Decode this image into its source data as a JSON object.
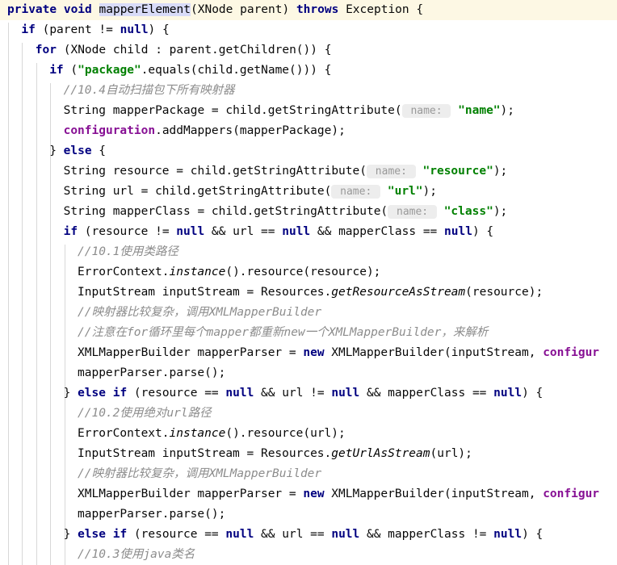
{
  "editor": {
    "language": "java",
    "theme": "IntelliJ Light",
    "colors": {
      "background": "#ffffff",
      "current_line_highlight": "#fdf8e4",
      "identifier_occurrence_highlight": "#d8dbf8",
      "keyword": "#000080",
      "string": "#008000",
      "comment": "#8c8c8c",
      "field": "#871094",
      "plain_text": "#080808",
      "indent_guide": "#d8d8d8",
      "param_hint_background": "#ededed",
      "param_hint_text": "#999999"
    },
    "indent_guide_x": [
      10,
      27,
      45,
      62,
      80,
      97
    ],
    "line_height": 25
  },
  "code_lines": [
    {
      "n": 1,
      "indent": 0,
      "current": true,
      "tokens": [
        {
          "t": "private",
          "c": "kw"
        },
        {
          "t": " ",
          "c": "pln"
        },
        {
          "t": "void",
          "c": "kw"
        },
        {
          "t": " ",
          "c": "pln"
        },
        {
          "t": "mapperElement",
          "c": "sel"
        },
        {
          "t": "(XNode parent) ",
          "c": "pln"
        },
        {
          "t": "throws",
          "c": "kw"
        },
        {
          "t": " Exception {",
          "c": "pln"
        }
      ]
    },
    {
      "n": 2,
      "indent": 1,
      "tokens": [
        {
          "t": "if",
          "c": "kw"
        },
        {
          "t": " (parent != ",
          "c": "pln"
        },
        {
          "t": "null",
          "c": "kw"
        },
        {
          "t": ") {",
          "c": "pln"
        }
      ]
    },
    {
      "n": 3,
      "indent": 2,
      "tokens": [
        {
          "t": "for",
          "c": "kw"
        },
        {
          "t": " (XNode child : parent.getChildren()) {",
          "c": "pln"
        }
      ]
    },
    {
      "n": 4,
      "indent": 3,
      "tokens": [
        {
          "t": "if",
          "c": "kw"
        },
        {
          "t": " (",
          "c": "pln"
        },
        {
          "t": "\"package\"",
          "c": "str"
        },
        {
          "t": ".equals(child.getName())) {",
          "c": "pln"
        }
      ]
    },
    {
      "n": 5,
      "indent": 4,
      "tokens": [
        {
          "t": "//10.4自动扫描包下所有映射器",
          "c": "cmt"
        }
      ]
    },
    {
      "n": 6,
      "indent": 4,
      "tokens": [
        {
          "t": "String mapperPackage = child.getStringAttribute(",
          "c": "pln"
        },
        {
          "t": " name: ",
          "c": "hint"
        },
        {
          "t": " ",
          "c": "pln"
        },
        {
          "t": "\"name\"",
          "c": "str"
        },
        {
          "t": ");",
          "c": "pln"
        }
      ]
    },
    {
      "n": 7,
      "indent": 4,
      "tokens": [
        {
          "t": "configuration",
          "c": "fld"
        },
        {
          "t": ".addMappers(mapperPackage);",
          "c": "pln"
        }
      ]
    },
    {
      "n": 8,
      "indent": 3,
      "tokens": [
        {
          "t": "} ",
          "c": "pln"
        },
        {
          "t": "else",
          "c": "kw"
        },
        {
          "t": " {",
          "c": "pln"
        }
      ]
    },
    {
      "n": 9,
      "indent": 4,
      "tokens": [
        {
          "t": "String resource = child.getStringAttribute(",
          "c": "pln"
        },
        {
          "t": " name: ",
          "c": "hint"
        },
        {
          "t": " ",
          "c": "pln"
        },
        {
          "t": "\"resource\"",
          "c": "str"
        },
        {
          "t": ");",
          "c": "pln"
        }
      ]
    },
    {
      "n": 10,
      "indent": 4,
      "tokens": [
        {
          "t": "String url = child.getStringAttribute(",
          "c": "pln"
        },
        {
          "t": " name: ",
          "c": "hint"
        },
        {
          "t": " ",
          "c": "pln"
        },
        {
          "t": "\"url\"",
          "c": "str"
        },
        {
          "t": ");",
          "c": "pln"
        }
      ]
    },
    {
      "n": 11,
      "indent": 4,
      "tokens": [
        {
          "t": "String mapperClass = child.getStringAttribute(",
          "c": "pln"
        },
        {
          "t": " name: ",
          "c": "hint"
        },
        {
          "t": " ",
          "c": "pln"
        },
        {
          "t": "\"class\"",
          "c": "str"
        },
        {
          "t": ");",
          "c": "pln"
        }
      ]
    },
    {
      "n": 12,
      "indent": 4,
      "tokens": [
        {
          "t": "if",
          "c": "kw"
        },
        {
          "t": " (resource != ",
          "c": "pln"
        },
        {
          "t": "null",
          "c": "kw"
        },
        {
          "t": " && url == ",
          "c": "pln"
        },
        {
          "t": "null",
          "c": "kw"
        },
        {
          "t": " && mapperClass == ",
          "c": "pln"
        },
        {
          "t": "null",
          "c": "kw"
        },
        {
          "t": ") {",
          "c": "pln"
        }
      ]
    },
    {
      "n": 13,
      "indent": 5,
      "tokens": [
        {
          "t": "//10.1使用类路径",
          "c": "cmt"
        }
      ]
    },
    {
      "n": 14,
      "indent": 5,
      "tokens": [
        {
          "t": "ErrorContext.",
          "c": "pln"
        },
        {
          "t": "instance",
          "c": "stm"
        },
        {
          "t": "().resource(resource);",
          "c": "pln"
        }
      ]
    },
    {
      "n": 15,
      "indent": 5,
      "tokens": [
        {
          "t": "InputStream inputStream = Resources.",
          "c": "pln"
        },
        {
          "t": "getResourceAsStream",
          "c": "stm"
        },
        {
          "t": "(resource);",
          "c": "pln"
        }
      ]
    },
    {
      "n": 16,
      "indent": 5,
      "tokens": [
        {
          "t": "//映射器比较复杂，调用XMLMapperBuilder",
          "c": "cmt"
        }
      ]
    },
    {
      "n": 17,
      "indent": 5,
      "tokens": [
        {
          "t": "//注意在for循环里每个mapper都重新new一个XMLMapperBuilder，来解析",
          "c": "cmt"
        }
      ]
    },
    {
      "n": 18,
      "indent": 5,
      "tokens": [
        {
          "t": "XMLMapperBuilder mapperParser = ",
          "c": "pln"
        },
        {
          "t": "new",
          "c": "kw"
        },
        {
          "t": " XMLMapperBuilder(inputStream, ",
          "c": "pln"
        },
        {
          "t": "configur",
          "c": "fld"
        }
      ]
    },
    {
      "n": 19,
      "indent": 5,
      "tokens": [
        {
          "t": "mapperParser.parse();",
          "c": "pln"
        }
      ]
    },
    {
      "n": 20,
      "indent": 4,
      "tokens": [
        {
          "t": "} ",
          "c": "pln"
        },
        {
          "t": "else if",
          "c": "kw"
        },
        {
          "t": " (resource == ",
          "c": "pln"
        },
        {
          "t": "null",
          "c": "kw"
        },
        {
          "t": " && url != ",
          "c": "pln"
        },
        {
          "t": "null",
          "c": "kw"
        },
        {
          "t": " && mapperClass == ",
          "c": "pln"
        },
        {
          "t": "null",
          "c": "kw"
        },
        {
          "t": ") {",
          "c": "pln"
        }
      ]
    },
    {
      "n": 21,
      "indent": 5,
      "tokens": [
        {
          "t": "//10.2使用绝对url路径",
          "c": "cmt"
        }
      ]
    },
    {
      "n": 22,
      "indent": 5,
      "tokens": [
        {
          "t": "ErrorContext.",
          "c": "pln"
        },
        {
          "t": "instance",
          "c": "stm"
        },
        {
          "t": "().resource(url);",
          "c": "pln"
        }
      ]
    },
    {
      "n": 23,
      "indent": 5,
      "tokens": [
        {
          "t": "InputStream inputStream = Resources.",
          "c": "pln"
        },
        {
          "t": "getUrlAsStream",
          "c": "stm"
        },
        {
          "t": "(url);",
          "c": "pln"
        }
      ]
    },
    {
      "n": 24,
      "indent": 5,
      "tokens": [
        {
          "t": "//映射器比较复杂，调用XMLMapperBuilder",
          "c": "cmt"
        }
      ]
    },
    {
      "n": 25,
      "indent": 5,
      "tokens": [
        {
          "t": "XMLMapperBuilder mapperParser = ",
          "c": "pln"
        },
        {
          "t": "new",
          "c": "kw"
        },
        {
          "t": " XMLMapperBuilder(inputStream, ",
          "c": "pln"
        },
        {
          "t": "configur",
          "c": "fld"
        }
      ]
    },
    {
      "n": 26,
      "indent": 5,
      "tokens": [
        {
          "t": "mapperParser.parse();",
          "c": "pln"
        }
      ]
    },
    {
      "n": 27,
      "indent": 4,
      "tokens": [
        {
          "t": "} ",
          "c": "pln"
        },
        {
          "t": "else if",
          "c": "kw"
        },
        {
          "t": " (resource == ",
          "c": "pln"
        },
        {
          "t": "null",
          "c": "kw"
        },
        {
          "t": " && url == ",
          "c": "pln"
        },
        {
          "t": "null",
          "c": "kw"
        },
        {
          "t": " && mapperClass != ",
          "c": "pln"
        },
        {
          "t": "null",
          "c": "kw"
        },
        {
          "t": ") {",
          "c": "pln"
        }
      ]
    },
    {
      "n": 28,
      "indent": 5,
      "tokens": [
        {
          "t": "//10.3使用java类名",
          "c": "cmt"
        }
      ]
    }
  ]
}
